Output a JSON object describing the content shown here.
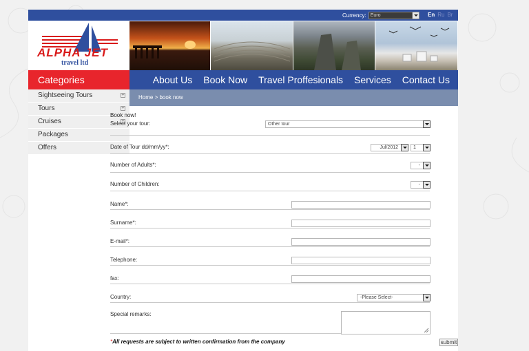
{
  "topbar": {
    "currency_label": "Currency:",
    "currency_value": "Euro",
    "languages": [
      "En",
      "Ru",
      "Br"
    ]
  },
  "logo": {
    "name": "ALPHA JET",
    "sub": "travel ltd"
  },
  "categories_title": "Categories",
  "nav": [
    "About Us",
    "Book Now",
    "Travel Proffesionals",
    "Services",
    "Contact Us"
  ],
  "sidebar": {
    "items": [
      {
        "label": "Sightseeing Tours",
        "expandable": true
      },
      {
        "label": "Tours",
        "expandable": true
      },
      {
        "label": "Cruises",
        "expandable": true
      },
      {
        "label": "Packages",
        "expandable": false
      },
      {
        "label": "Offers",
        "expandable": false
      }
    ]
  },
  "breadcrumb": "Home  >  book now",
  "form": {
    "title": "Book now!",
    "tour_label": "Select your tour:",
    "tour_value": "Other tour",
    "date_label": "Date of Tour dd/mm/yy*:",
    "date_month": "Jul/2012",
    "date_day": "1",
    "adults_label": "Number of Adults*:",
    "adults_value": "-",
    "children_label": "Number of Children:",
    "children_value": "-",
    "name_label": "Name*:",
    "surname_label": "Surname*:",
    "email_label": "E-mail*:",
    "telephone_label": "Telephone:",
    "fax_label": "fax:",
    "country_label": "Country:",
    "country_value": "-Please Select-",
    "remarks_label": "Special remarks:",
    "note_asterisk": "*",
    "note_text": "All requests are subject to written confirmation from the company",
    "submit_label": "submit"
  },
  "colors": {
    "brand_blue": "#2f4f9e",
    "brand_red": "#e8252c",
    "breadcrumb": "#7a8dae"
  }
}
